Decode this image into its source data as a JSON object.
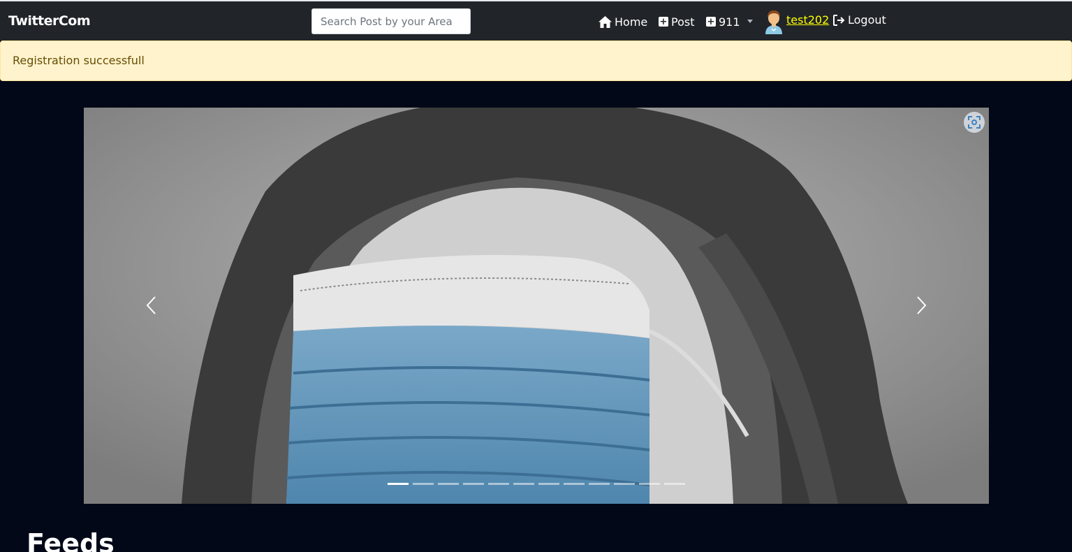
{
  "navbar": {
    "brand": "TwitterCom",
    "search_placeholder": "Search Post by your Area",
    "home_label": "Home",
    "post_label": "Post",
    "emergency_label": "911",
    "username": "test202",
    "logout_label": "Logout"
  },
  "alert": {
    "message": "Registration successfull"
  },
  "carousel": {
    "slide_count": 12,
    "active_index": 0
  },
  "main": {
    "heading": "Feeds"
  },
  "colors": {
    "navbar_bg": "#212529",
    "page_bg": "#020817",
    "alert_bg": "#fff3cd",
    "alert_text": "#664d03",
    "username": "#ffff00"
  }
}
